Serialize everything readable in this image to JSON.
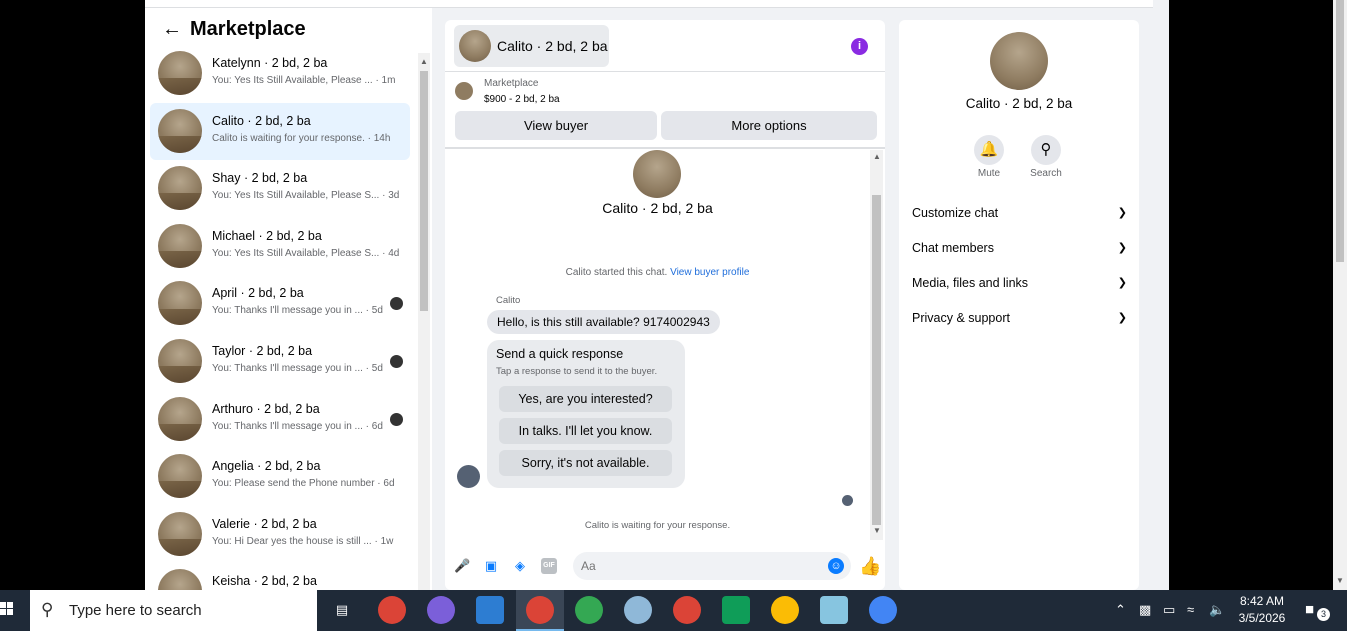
{
  "marketplace": {
    "title": "Marketplace",
    "conversations": [
      {
        "name": "Katelynn · 2 bd, 2 ba",
        "preview": "You: Yes Its Still Available, Please ... · 1m",
        "active": false,
        "mini": false
      },
      {
        "name": "Calito · 2 bd, 2 ba",
        "preview": "Calito is waiting for your response. · 14h",
        "active": true,
        "mini": false
      },
      {
        "name": "Shay · 2 bd, 2 ba",
        "preview": "You: Yes Its Still Available, Please S... · 3d",
        "active": false,
        "mini": false
      },
      {
        "name": "Michael · 2 bd, 2 ba",
        "preview": "You: Yes Its Still Available, Please S... · 4d",
        "active": false,
        "mini": false
      },
      {
        "name": "April · 2 bd, 2 ba",
        "preview": "You: Thanks I'll message you in ... · 5d",
        "active": false,
        "mini": true
      },
      {
        "name": "Taylor · 2 bd, 2 ba",
        "preview": "You: Thanks I'll message you in ... · 5d",
        "active": false,
        "mini": true
      },
      {
        "name": "Arthuro · 2 bd, 2 ba",
        "preview": "You: Thanks I'll message you in ... · 6d",
        "active": false,
        "mini": true
      },
      {
        "name": "Angelia · 2 bd, 2 ba",
        "preview": "You: Please send the Phone number · 6d",
        "active": false,
        "mini": false
      },
      {
        "name": "Valerie · 2 bd, 2 ba",
        "preview": "You: Hi Dear yes the house is still ... · 1w",
        "active": false,
        "mini": false
      },
      {
        "name": "Keisha · 2 bd, 2 ba",
        "preview": "",
        "active": false,
        "mini": false
      }
    ]
  },
  "chat": {
    "header_title": "Calito · 2 bd, 2 ba",
    "info_icon": "i",
    "listing_source": "Marketplace",
    "listing_detail": "$900 - 2 bd, 2 ba",
    "view_buyer_label": "View buyer",
    "more_options_label": "More options",
    "contact_name": "Calito · 2 bd, 2 ba",
    "started_text": "Calito started this chat.",
    "view_profile_link": "View buyer profile",
    "sender_name": "Calito",
    "message_text": "Hello, is this still available? 9174002943",
    "quick_title": "Send a quick response",
    "quick_subtitle": "Tap a response to send it to the buyer.",
    "quick_responses": [
      "Yes, are you interested?",
      "In talks. I'll let you know.",
      "Sorry, it's not available."
    ],
    "waiting_text": "Calito is waiting for your response.",
    "composer_placeholder": "Aa",
    "composer_icons": [
      "microphone-icon",
      "photo-icon",
      "sticker-icon",
      "gif-icon",
      "emoji-icon",
      "thumbs-up-icon"
    ]
  },
  "details": {
    "name": "Calito · 2 bd, 2 ba",
    "mute_label": "Mute",
    "search_label": "Search",
    "sections": [
      "Customize chat",
      "Chat members",
      "Media, files and links",
      "Privacy & support"
    ]
  },
  "taskbar": {
    "search_placeholder": "Type here to search",
    "time": "8:42 AM",
    "date": "3/5/2026",
    "notification_count": "3"
  }
}
